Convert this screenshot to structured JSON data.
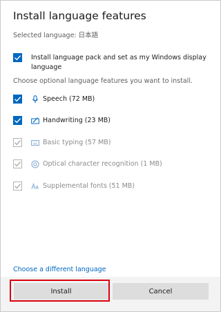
{
  "dialog": {
    "title": "Install language features",
    "selected_language": "Selected language: 日本語",
    "primary_option": {
      "line1": "Install language pack and set as my Windows display",
      "line2": "language",
      "checked": true
    },
    "hint": "Choose optional language features you want to install.",
    "features": [
      {
        "label": "Speech (72 MB)",
        "icon": "microphone-icon",
        "checked": true,
        "enabled": true
      },
      {
        "label": "Handwriting (23 MB)",
        "icon": "pen-icon",
        "checked": true,
        "enabled": true
      },
      {
        "label": "Basic typing (57 MB)",
        "icon": "keyboard-icon",
        "checked": true,
        "enabled": false
      },
      {
        "label": "Optical character recognition (1 MB)",
        "icon": "ocr-icon",
        "checked": true,
        "enabled": false
      },
      {
        "label": "Supplemental fonts (51 MB)",
        "icon": "font-icon",
        "checked": true,
        "enabled": false
      }
    ],
    "change_language_link": "Choose a different language",
    "buttons": {
      "install": "Install",
      "cancel": "Cancel"
    },
    "colors": {
      "accent": "#0067c0",
      "highlight": "#d9000d"
    }
  }
}
